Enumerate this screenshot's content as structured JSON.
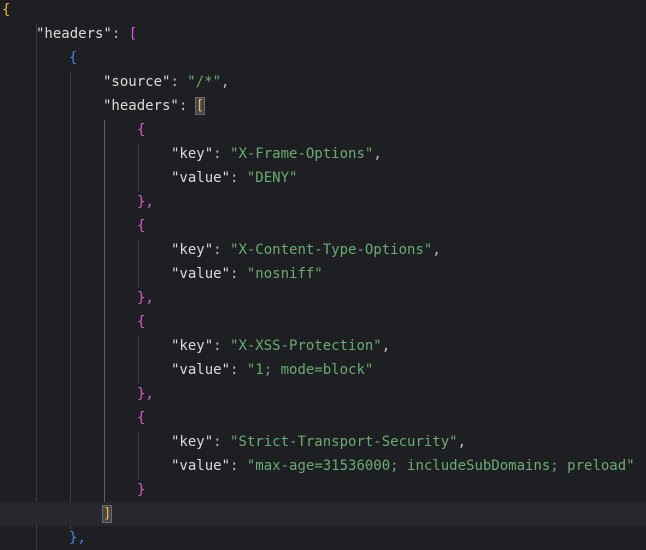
{
  "editor": {
    "colors": {
      "background": "#1e1f22",
      "current_line": "#26282e",
      "string": "#6aab73",
      "key": "#dcdcdc",
      "bracket_level_1": "#e8ba36",
      "bracket_level_2": "#d95bd1",
      "bracket_level_3": "#3d8ae8"
    },
    "code": {
      "open_root": "{",
      "headers_key": "\"headers\"",
      "colon": ": ",
      "open_headers_array": "[",
      "open_rule_object": "{",
      "source_key": "\"source\"",
      "source_value": "\"/*\"",
      "comma": ",",
      "inner_headers_key": "\"headers\"",
      "open_inner_array": "[",
      "entries": [
        {
          "open": "{",
          "key_name": "\"key\"",
          "key_value": "\"X-Frame-Options\"",
          "value_name": "\"value\"",
          "value_value": "\"DENY\"",
          "close": "},"
        },
        {
          "open": "{",
          "key_name": "\"key\"",
          "key_value": "\"X-Content-Type-Options\"",
          "value_name": "\"value\"",
          "value_value": "\"nosniff\"",
          "close": "},"
        },
        {
          "open": "{",
          "key_name": "\"key\"",
          "key_value": "\"X-XSS-Protection\"",
          "value_name": "\"value\"",
          "value_value": "\"1; mode=block\"",
          "close": "},"
        },
        {
          "open": "{",
          "key_name": "\"key\"",
          "key_value": "\"Strict-Transport-Security\"",
          "value_name": "\"value\"",
          "value_value": "\"max-age=31536000; includeSubDomains; preload\"",
          "close": "}"
        }
      ],
      "close_inner_array": "]",
      "close_rule_object": "},"
    }
  }
}
